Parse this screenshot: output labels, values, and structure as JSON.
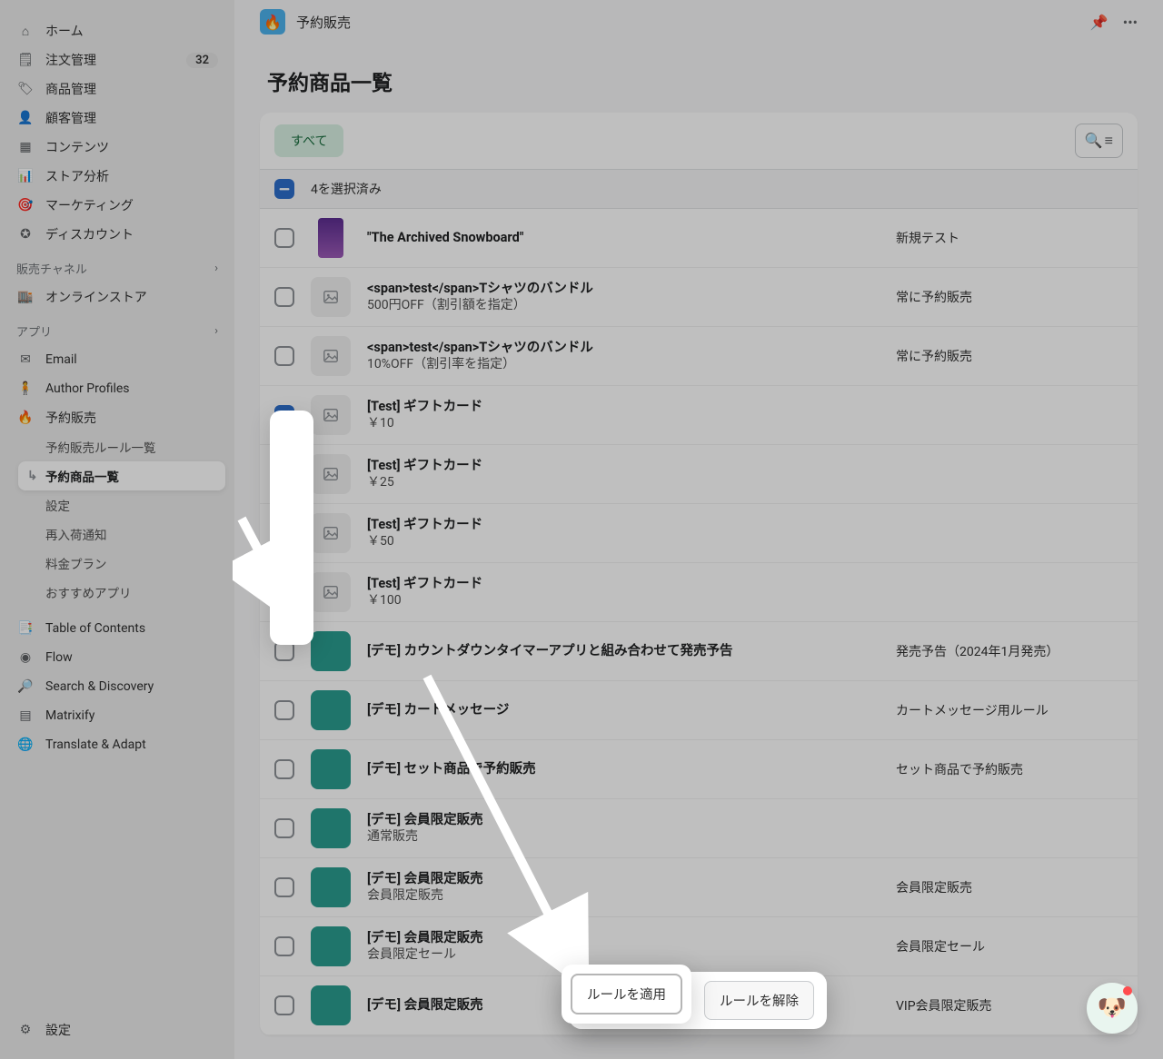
{
  "sidebar": {
    "items": [
      {
        "label": "ホーム",
        "icon": "home"
      },
      {
        "label": "注文管理",
        "icon": "orders",
        "badge": "32"
      },
      {
        "label": "商品管理",
        "icon": "tag"
      },
      {
        "label": "顧客管理",
        "icon": "user"
      },
      {
        "label": "コンテンツ",
        "icon": "content"
      },
      {
        "label": "ストア分析",
        "icon": "chart"
      },
      {
        "label": "マーケティング",
        "icon": "target"
      },
      {
        "label": "ディスカウント",
        "icon": "discount"
      }
    ],
    "channels_label": "販売チャネル",
    "channels": [
      {
        "label": "オンラインストア",
        "icon": "store"
      }
    ],
    "apps_label": "アプリ",
    "apps": [
      {
        "label": "Email",
        "icon": "mail"
      },
      {
        "label": "Author Profiles",
        "icon": "profile"
      },
      {
        "label": "予約販売",
        "icon": "preorder"
      }
    ],
    "subnav": [
      {
        "label": "予約販売ルール一覧"
      },
      {
        "label": "予約商品一覧",
        "active": true
      },
      {
        "label": "設定"
      },
      {
        "label": "再入荷通知"
      },
      {
        "label": "料金プラン"
      },
      {
        "label": "おすすめアプリ"
      }
    ],
    "more_apps": [
      {
        "label": "Table of Contents",
        "icon": "toc"
      },
      {
        "label": "Flow",
        "icon": "flow"
      },
      {
        "label": "Search & Discovery",
        "icon": "search"
      },
      {
        "label": "Matrixify",
        "icon": "matrix"
      },
      {
        "label": "Translate & Adapt",
        "icon": "translate"
      }
    ],
    "settings_label": "設定"
  },
  "topbar": {
    "title": "予約販売"
  },
  "page": {
    "title": "予約商品一覧"
  },
  "filter": {
    "all": "すべて"
  },
  "selection": {
    "count": "4",
    "suffix": "を選択済み"
  },
  "rows": [
    {
      "title": "\"The Archived Snowboard\"",
      "sub": "",
      "rule": "新規テスト",
      "thumb": "purple",
      "checked": false
    },
    {
      "title": "<span>test</span>Tシャツのバンドル",
      "sub": "500円OFF（割引額を指定）",
      "rule": "常に予約販売",
      "thumb": "img",
      "checked": false
    },
    {
      "title": "<span>test</span>Tシャツのバンドル",
      "sub": "10%OFF（割引率を指定）",
      "rule": "常に予約販売",
      "thumb": "img",
      "checked": false
    },
    {
      "title": "[Test] ギフトカード",
      "sub": "￥10",
      "rule": "",
      "thumb": "img",
      "checked": true
    },
    {
      "title": "[Test] ギフトカード",
      "sub": "￥25",
      "rule": "",
      "thumb": "img",
      "checked": true
    },
    {
      "title": "[Test] ギフトカード",
      "sub": "￥50",
      "rule": "",
      "thumb": "img",
      "checked": true
    },
    {
      "title": "[Test] ギフトカード",
      "sub": "￥100",
      "rule": "",
      "thumb": "img",
      "checked": true
    },
    {
      "title": "[デモ] カウントダウンタイマーアプリと組み合わせて発売予告",
      "sub": "",
      "rule": "発売予告（2024年1月発売）",
      "thumb": "teal",
      "checked": false
    },
    {
      "title": "[デモ] カートメッセージ",
      "sub": "",
      "rule": "カートメッセージ用ルール",
      "thumb": "teal",
      "checked": false
    },
    {
      "title": "[デモ] セット商品で予約販売",
      "sub": "",
      "rule": "セット商品で予約販売",
      "thumb": "teal",
      "checked": false
    },
    {
      "title": "[デモ] 会員限定販売",
      "sub": "通常販売",
      "rule": "",
      "thumb": "teal",
      "checked": false
    },
    {
      "title": "[デモ] 会員限定販売",
      "sub": "会員限定販売",
      "rule": "会員限定販売",
      "thumb": "teal",
      "checked": false
    },
    {
      "title": "[デモ] 会員限定販売",
      "sub": "会員限定セール",
      "rule": "会員限定セール",
      "thumb": "teal",
      "checked": false
    },
    {
      "title": "[デモ] 会員限定販売",
      "sub": "",
      "rule": "VIP会員限定販売",
      "thumb": "teal",
      "checked": false
    }
  ],
  "actions": {
    "apply": "ルールを適用",
    "remove": "ルールを解除"
  }
}
